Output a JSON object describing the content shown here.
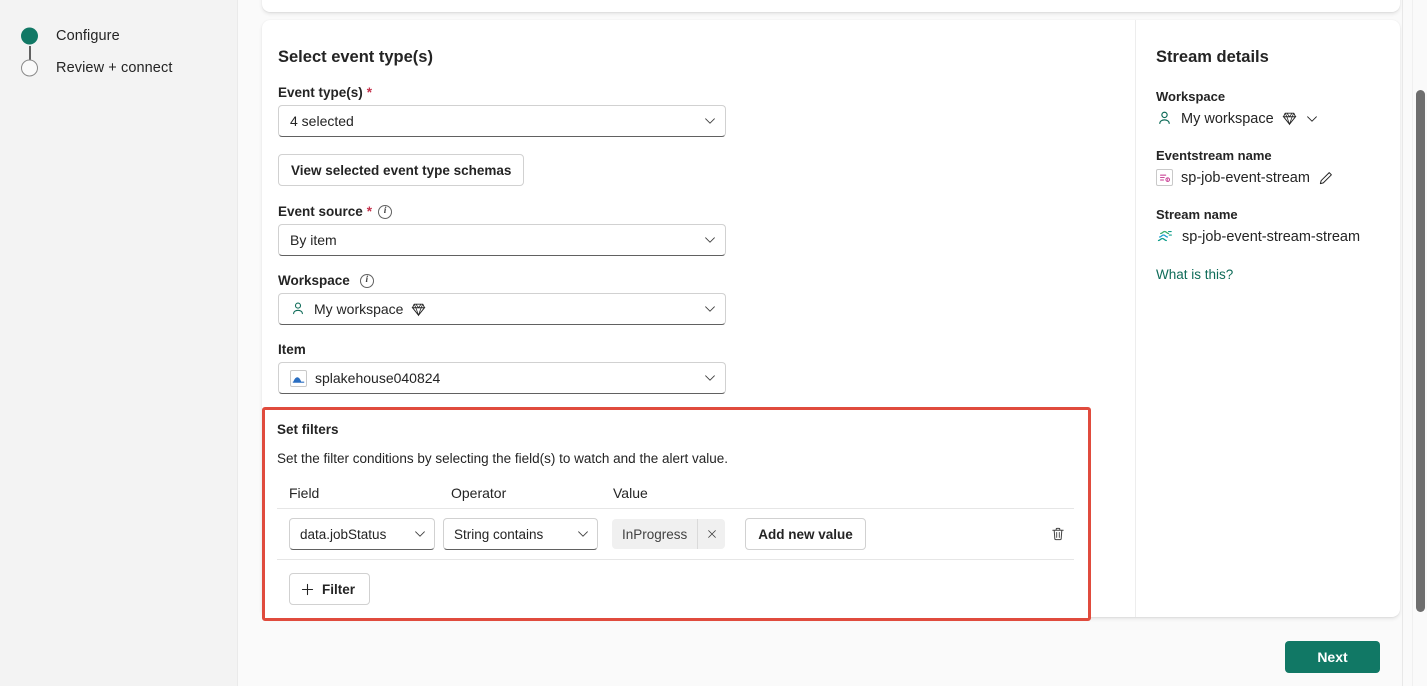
{
  "wizard": {
    "steps": [
      {
        "label": "Configure",
        "state": "current"
      },
      {
        "label": "Review + connect",
        "state": "pending"
      }
    ]
  },
  "main": {
    "section_title": "Select event type(s)",
    "fields": {
      "event_types": {
        "label": "Event type(s)",
        "required": "*",
        "value": "4 selected",
        "chevron_icon": "chevron-down-icon"
      },
      "view_schemas_button": "View selected event type schemas",
      "event_source": {
        "label": "Event source",
        "required": "*",
        "info_icon": "info-icon",
        "value": "By item",
        "chevron_icon": "chevron-down-icon"
      },
      "workspace": {
        "label": "Workspace",
        "info_icon": "info-icon",
        "value": "My workspace",
        "person_icon": "person-icon",
        "capacity_icon": "diamond-icon",
        "chevron_icon": "chevron-down-icon"
      },
      "item": {
        "label": "Item",
        "value": "splakehouse040824",
        "item_icon": "lakehouse-icon",
        "chevron_icon": "chevron-down-icon"
      }
    },
    "filters": {
      "title": "Set filters",
      "description": "Set the filter conditions by selecting the field(s) to watch and the alert value.",
      "columns": [
        "Field",
        "Operator",
        "Value"
      ],
      "rows": [
        {
          "field": "data.jobStatus",
          "operator": "String contains",
          "values": [
            "InProgress"
          ],
          "remove_value_icon": "close-icon",
          "add_value_button": "Add new value",
          "delete_row_icon": "trash-icon"
        }
      ],
      "add_filter_button": "Filter",
      "add_filter_icon": "plus-icon",
      "highlight_color": "#e04b3d"
    }
  },
  "stream_details": {
    "title": "Stream details",
    "workspace_label": "Workspace",
    "workspace_value": "My workspace",
    "workspace_person_icon": "person-icon",
    "workspace_capacity_icon": "diamond-icon",
    "workspace_chevron_icon": "chevron-down-icon",
    "eventstream_label": "Eventstream name",
    "eventstream_value": "sp-job-event-stream",
    "eventstream_icon": "eventstream-icon",
    "eventstream_edit_icon": "pencil-icon",
    "stream_label": "Stream name",
    "stream_value": "sp-job-event-stream-stream",
    "stream_icon": "stream-icon",
    "help_link": "What is this?"
  },
  "footer": {
    "next_button": "Next",
    "accent_color": "#117865"
  }
}
